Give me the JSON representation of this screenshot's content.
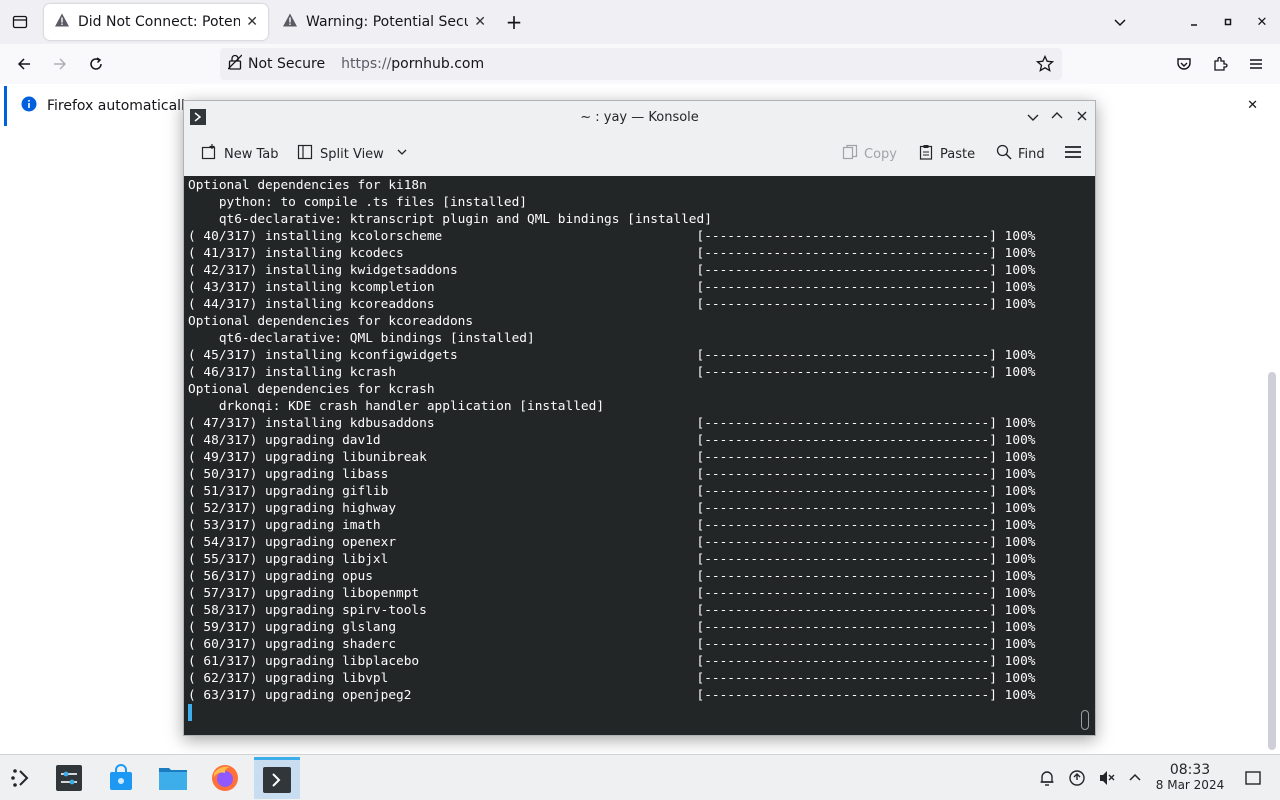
{
  "firefox": {
    "tabs": [
      {
        "title": "Did Not Connect: Potenti",
        "icon": "warning-icon",
        "active": true
      },
      {
        "title": "Warning: Potential Secur",
        "icon": "warning-icon",
        "active": false
      }
    ],
    "url_security": "Not Secure",
    "url_scheme": "https://",
    "url_host": "pornhub.com",
    "notification": "Firefox automatically"
  },
  "konsole": {
    "title": "~ : yay — Konsole",
    "toolbar": {
      "new_tab": "New Tab",
      "split_view": "Split View",
      "copy": "Copy",
      "paste": "Paste",
      "find": "Find"
    },
    "lines": [
      "Optional dependencies for ki18n",
      "    python: to compile .ts files [installed]",
      "    qt6-declarative: ktranscript plugin and QML bindings [installed]",
      "( 40/317) installing kcolorscheme                                 [-------------------------------------] 100%",
      "( 41/317) installing kcodecs                                      [-------------------------------------] 100%",
      "( 42/317) installing kwidgetsaddons                               [-------------------------------------] 100%",
      "( 43/317) installing kcompletion                                  [-------------------------------------] 100%",
      "( 44/317) installing kcoreaddons                                  [-------------------------------------] 100%",
      "Optional dependencies for kcoreaddons",
      "    qt6-declarative: QML bindings [installed]",
      "( 45/317) installing kconfigwidgets                               [-------------------------------------] 100%",
      "( 46/317) installing kcrash                                       [-------------------------------------] 100%",
      "Optional dependencies for kcrash",
      "    drkonqi: KDE crash handler application [installed]",
      "( 47/317) installing kdbusaddons                                  [-------------------------------------] 100%",
      "( 48/317) upgrading dav1d                                         [-------------------------------------] 100%",
      "( 49/317) upgrading libunibreak                                   [-------------------------------------] 100%",
      "( 50/317) upgrading libass                                        [-------------------------------------] 100%",
      "( 51/317) upgrading giflib                                        [-------------------------------------] 100%",
      "( 52/317) upgrading highway                                       [-------------------------------------] 100%",
      "( 53/317) upgrading imath                                         [-------------------------------------] 100%",
      "( 54/317) upgrading openexr                                       [-------------------------------------] 100%",
      "( 55/317) upgrading libjxl                                        [-------------------------------------] 100%",
      "( 56/317) upgrading opus                                          [-------------------------------------] 100%",
      "( 57/317) upgrading libopenmpt                                    [-------------------------------------] 100%",
      "( 58/317) upgrading spirv-tools                                   [-------------------------------------] 100%",
      "( 59/317) upgrading glslang                                       [-------------------------------------] 100%",
      "( 60/317) upgrading shaderc                                       [-------------------------------------] 100%",
      "( 61/317) upgrading libplacebo                                    [-------------------------------------] 100%",
      "( 62/317) upgrading libvpl                                        [-------------------------------------] 100%",
      "( 63/317) upgrading openjpeg2                                     [-------------------------------------] 100%"
    ]
  },
  "taskbar": {
    "time": "08:33",
    "date": "8 Mar 2024",
    "items": [
      "application-launcher-icon",
      "system-settings-icon",
      "discover-store-icon",
      "file-manager-icon",
      "firefox-icon",
      "konsole-icon"
    ],
    "tray": [
      "notifications-icon",
      "update-icon",
      "volume-muted-icon",
      "tray-expand-icon",
      "show-desktop-icon"
    ]
  },
  "colors": {
    "terminal_bg": "#232627",
    "accent": "#3daee9",
    "ff_accent": "#0060df"
  }
}
